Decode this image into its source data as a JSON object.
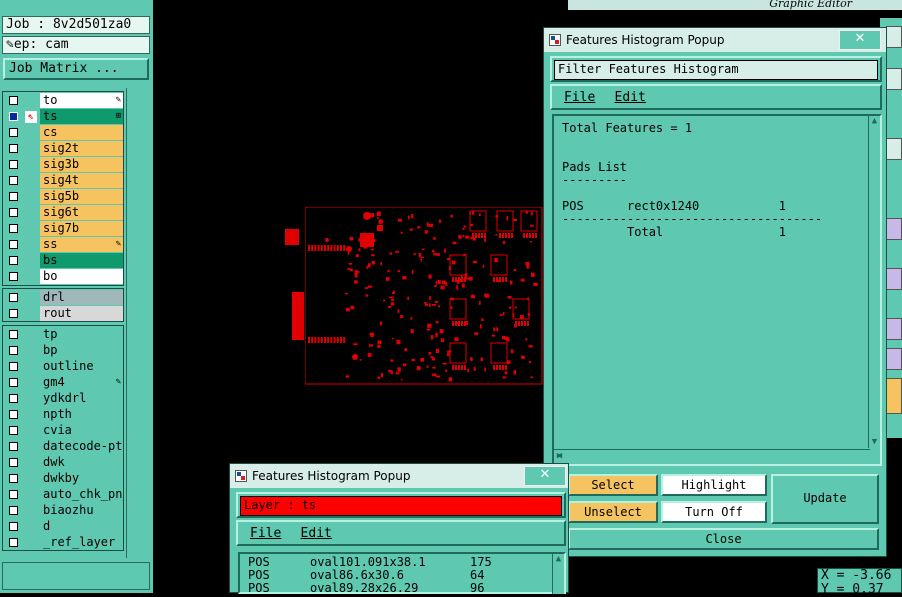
{
  "left": {
    "job_line": "Job : 8v2d501za0",
    "step_line": "ep: cam",
    "job_matrix_button": "Job Matrix ...",
    "layers_group1": [
      {
        "name": "to",
        "bg": "#ffffff",
        "mark": "✎",
        "checked": false,
        "arrow": false
      },
      {
        "name": "ts",
        "bg": "#0f9a6e",
        "mark": "⊞",
        "checked": true,
        "arrow": true
      },
      {
        "name": "cs",
        "bg": "#f5c460",
        "mark": "",
        "checked": false,
        "arrow": false
      },
      {
        "name": "sig2t",
        "bg": "#f5c460",
        "mark": "",
        "checked": false,
        "arrow": false
      },
      {
        "name": "sig3b",
        "bg": "#f5c460",
        "mark": "",
        "checked": false,
        "arrow": false
      },
      {
        "name": "sig4t",
        "bg": "#f5c460",
        "mark": "",
        "checked": false,
        "arrow": false
      },
      {
        "name": "sig5b",
        "bg": "#f5c460",
        "mark": "",
        "checked": false,
        "arrow": false
      },
      {
        "name": "sig6t",
        "bg": "#f5c460",
        "mark": "",
        "checked": false,
        "arrow": false
      },
      {
        "name": "sig7b",
        "bg": "#f5c460",
        "mark": "",
        "checked": false,
        "arrow": false
      },
      {
        "name": "ss",
        "bg": "#f5c460",
        "mark": "✎",
        "checked": false,
        "arrow": false
      },
      {
        "name": "bs",
        "bg": "#0f9a6e",
        "mark": "",
        "checked": false,
        "arrow": false
      },
      {
        "name": "bo",
        "bg": "#ffffff",
        "mark": "",
        "checked": false,
        "arrow": false
      }
    ],
    "layers_group2": [
      {
        "name": "drl",
        "bg": "#9fb8b8",
        "mark": "",
        "checked": false,
        "arrow": false
      },
      {
        "name": "rout",
        "bg": "#d8d8d8",
        "mark": "",
        "checked": false,
        "arrow": false
      }
    ],
    "layers_group3": [
      {
        "name": "tp",
        "bg": "#5ec9b0",
        "mark": "",
        "checked": false,
        "arrow": false
      },
      {
        "name": "bp",
        "bg": "#5ec9b0",
        "mark": "",
        "checked": false,
        "arrow": false
      },
      {
        "name": "outline",
        "bg": "#5ec9b0",
        "mark": "",
        "checked": false,
        "arrow": false
      },
      {
        "name": "gm4",
        "bg": "#5ec9b0",
        "mark": "✎",
        "checked": false,
        "arrow": false
      },
      {
        "name": "ydkdrl",
        "bg": "#5ec9b0",
        "mark": "",
        "checked": false,
        "arrow": false
      },
      {
        "name": "npth",
        "bg": "#5ec9b0",
        "mark": "",
        "checked": false,
        "arrow": false
      },
      {
        "name": "cvia",
        "bg": "#5ec9b0",
        "mark": "",
        "checked": false,
        "arrow": false
      },
      {
        "name": "datecode-pto",
        "bg": "#5ec9b0",
        "mark": "",
        "checked": false,
        "arrow": false
      },
      {
        "name": "dwk",
        "bg": "#5ec9b0",
        "mark": "",
        "checked": false,
        "arrow": false
      },
      {
        "name": "dwkby",
        "bg": "#5ec9b0",
        "mark": "",
        "checked": false,
        "arrow": false
      },
      {
        "name": "auto_chk_pn_",
        "bg": "#5ec9b0",
        "mark": "",
        "checked": false,
        "arrow": false
      },
      {
        "name": "biaozhu",
        "bg": "#5ec9b0",
        "mark": "",
        "checked": false,
        "arrow": false
      },
      {
        "name": "d",
        "bg": "#5ec9b0",
        "mark": "",
        "checked": false,
        "arrow": false
      },
      {
        "name": "_ref_layer",
        "bg": "#5ec9b0",
        "mark": "",
        "checked": false,
        "arrow": false
      }
    ]
  },
  "graphic_editor_title": "Graphic Editor",
  "popup1": {
    "title": "Features Histogram Popup",
    "close": "✕",
    "header": "Filter Features Histogram",
    "menu_file": "File",
    "menu_edit": "Edit",
    "report": "Total Features = 1\n\n\nPads List\n---------\n\nPOS      rect0x1240           1\n------------------------------------\n         Total                1",
    "buttons": {
      "select": "Select",
      "highlight": "Highlight",
      "update": "Update",
      "unselect": "Unselect",
      "turn_off": "Turn Off",
      "close": "Close"
    }
  },
  "popup2": {
    "title": "Features Histogram Popup",
    "close": "✕",
    "header": "Layer :  ts",
    "menu_file": "File",
    "menu_edit": "Edit",
    "rows": [
      {
        "type": "POS",
        "name": "oval101.091x38.1",
        "count": "175"
      },
      {
        "type": "POS",
        "name": "oval86.6x30.6",
        "count": "64"
      },
      {
        "type": "POS",
        "name": "oval89.28x26.29",
        "count": "96"
      }
    ]
  },
  "coords": {
    "x": "X = -3.66",
    "y": "Y = 0.37"
  }
}
